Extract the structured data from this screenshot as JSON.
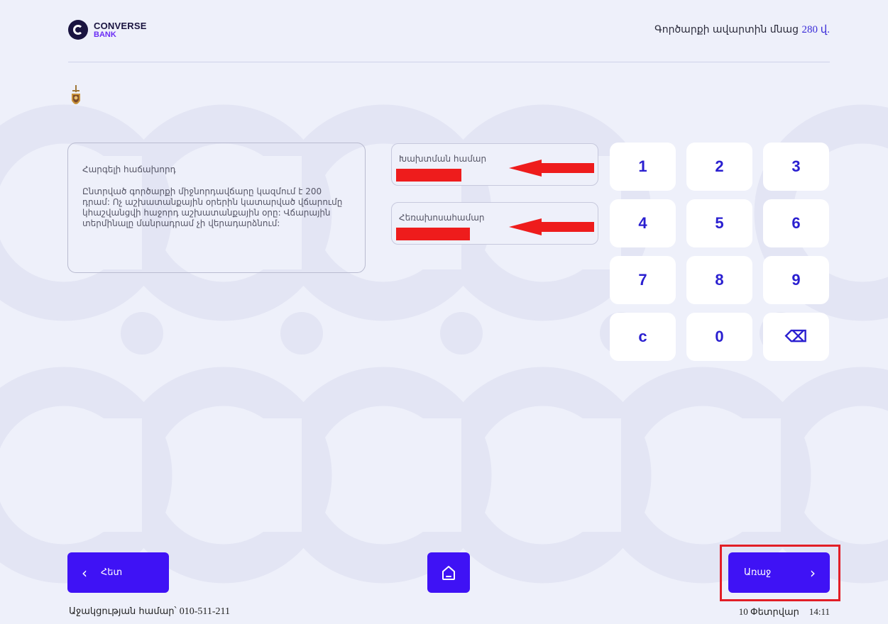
{
  "header": {
    "logo_name": "CONVERSE",
    "logo_sub": "BANK",
    "timer_text": "Գործարքի ավարտին մնաց",
    "timer_value": "280 վ."
  },
  "info": {
    "greeting": "Հարգելի հաճախորդ",
    "body": "Ընտրված գործարքի միջնորդավճարը կազմում է 200 դրամ: Ոչ աշխատանքային օրերին կատարված վճարումը կհաշվանցվի հաջորդ աշխատանքային օրը: Վճարային տերմինալը մանրադրամ չի վերադարձնում:"
  },
  "fields": [
    {
      "label": "Խախտման համար"
    },
    {
      "label": "Հեռախոսահամար"
    }
  ],
  "keypad": [
    "1",
    "2",
    "3",
    "4",
    "5",
    "6",
    "7",
    "8",
    "9",
    "c",
    "0",
    "⌫"
  ],
  "buttons": {
    "back": "Հետ",
    "next": "Առաջ"
  },
  "footer": {
    "support_label": "Աջակցության համար՝",
    "support_phone": "010-511-211",
    "date": "10 Փետրվար",
    "time": "14:11"
  },
  "colors": {
    "background": "#eef0fa",
    "accent": "#3f12f5",
    "key_text": "#2a1fd0",
    "highlight": "#e21e26",
    "redaction": "#ee1c1c"
  }
}
